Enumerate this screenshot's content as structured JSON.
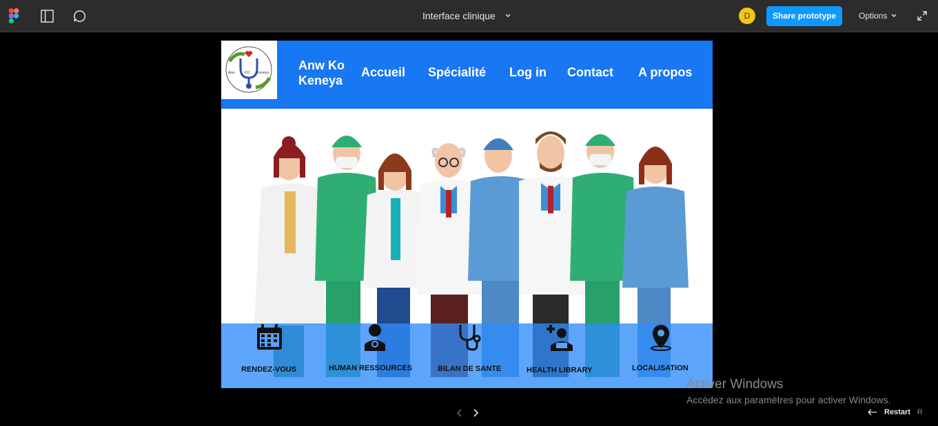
{
  "toolbar": {
    "file_title": "Interface clinique",
    "avatar_initial": "D",
    "share_label": "Share prototype",
    "options_label": "Options"
  },
  "site": {
    "logo_texts": [
      "Anw",
      "KO",
      "Keneya"
    ],
    "brand_line1": "Anw Ko",
    "brand_line2": "Keneya",
    "nav": [
      "Accueil",
      "Spécialité",
      "Log in",
      "Contact",
      "A propos"
    ],
    "services": [
      {
        "label": "RENDEZ-VOUS",
        "icon": "calendar-icon"
      },
      {
        "label": "HUMAN RESSOURCES",
        "icon": "doctor-icon"
      },
      {
        "label": "BILAN DE SANTE",
        "icon": "stethoscope-icon"
      },
      {
        "label": "HEALTH LIBRARY",
        "icon": "patient-book-icon"
      },
      {
        "label": "LOCALISATION",
        "icon": "map-pin-icon"
      }
    ]
  },
  "watermark": {
    "title": "Activer Windows",
    "subtitle": "Accédez aux paramètres pour activer Windows."
  },
  "footer": {
    "restart_label": "Restart",
    "restart_key": "R"
  },
  "colors": {
    "nav_blue": "#1877f2",
    "share_blue": "#0d99ff",
    "toolbar_bg": "#2c2c2c"
  }
}
